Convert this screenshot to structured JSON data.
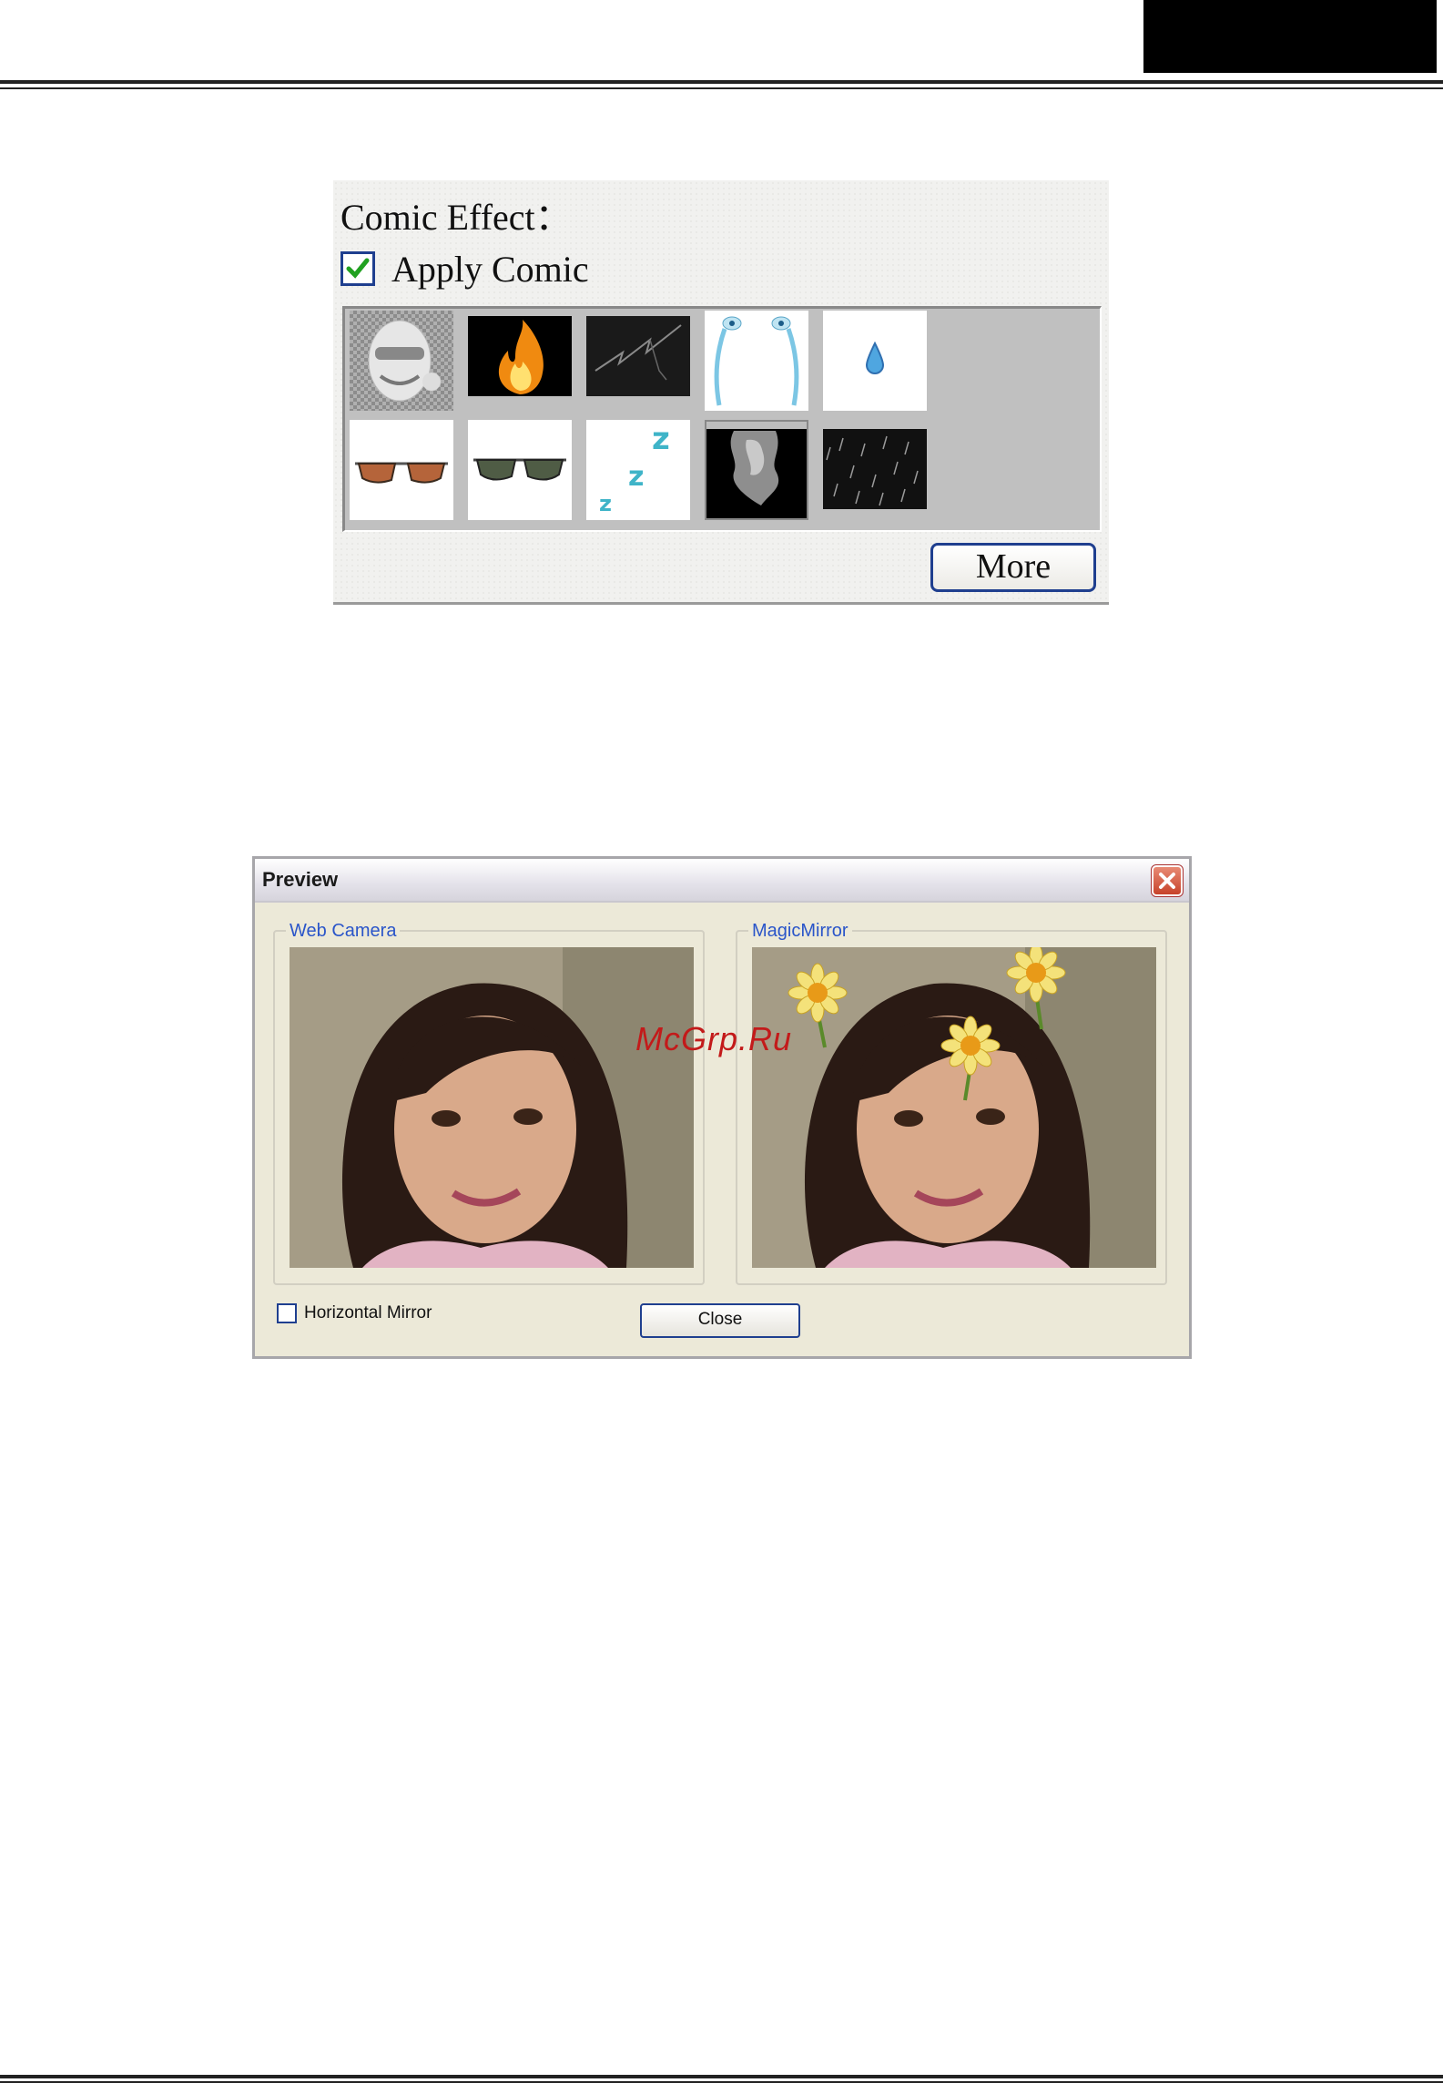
{
  "comic_panel": {
    "title": "Comic Effect：",
    "apply_label": "Apply Comic",
    "apply_checked": true,
    "more_label": "More",
    "thumbnails": [
      {
        "name": "mask-thumbnail",
        "selected": true
      },
      {
        "name": "fire-thumbnail"
      },
      {
        "name": "lightning-thumbnail"
      },
      {
        "name": "tears-thumbnail"
      },
      {
        "name": "drop-thumbnail"
      },
      {
        "name": "brown-sunglasses-thumbnail"
      },
      {
        "name": "green-sunglasses-thumbnail"
      },
      {
        "name": "zzz-thumbnail"
      },
      {
        "name": "smoke-thumbnail"
      },
      {
        "name": "rain-thumbnail"
      }
    ]
  },
  "preview_dialog": {
    "title": "Preview",
    "web_camera_label": "Web Camera",
    "magic_mirror_label": "MagicMirror",
    "horizontal_mirror_label": "Horizontal Mirror",
    "horizontal_mirror_checked": false,
    "close_label": "Close"
  },
  "watermark": "McGrp.Ru",
  "colors": {
    "accent_blue": "#1f3f8f",
    "group_label_blue": "#2a55c9",
    "dialog_bg": "#ece9d8",
    "watermark_red": "#c31a1a"
  }
}
